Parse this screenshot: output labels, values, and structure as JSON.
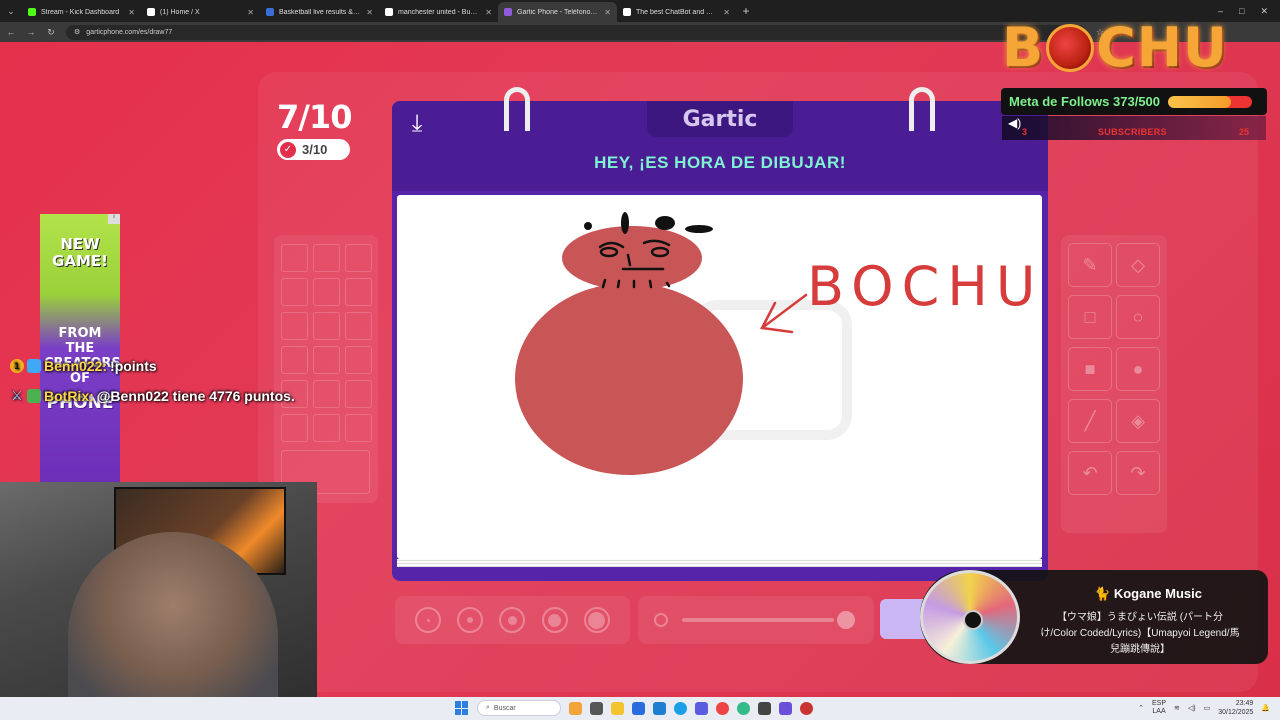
{
  "browser": {
    "tabs": [
      {
        "label": "Stream - Kick Dashboard",
        "favicon_color": "#53fc18",
        "active": false
      },
      {
        "label": "(1) Home / X",
        "favicon_color": "#ffffff",
        "active": false
      },
      {
        "label": "Basketball live results & schedu...",
        "favicon_color": "#3b6fd8",
        "active": false
      },
      {
        "label": "manchester united - Buscar con...",
        "favicon_color": "#ffffff",
        "active": false
      },
      {
        "label": "Gartic Phone - Teléfono De...",
        "favicon_color": "#8f5bd8",
        "active": true
      },
      {
        "label": "The best ChatBot and Widg...",
        "favicon_color": "#ffffff",
        "active": false
      }
    ],
    "url": "garticphone.com/es/draw77"
  },
  "game": {
    "round": "7/10",
    "players_done": "3/10",
    "logo": "Gartic",
    "instruction": "HEY, ¡ES HORA DE DIBUJAR!",
    "drawing_text": "BOCHU"
  },
  "palette": {
    "rows": 6,
    "cols": 3
  },
  "tools": [
    {
      "name": "pencil-tool-icon",
      "glyph": "✎"
    },
    {
      "name": "eraser-tool-icon",
      "glyph": "◇"
    },
    {
      "name": "rectangle-tool-icon",
      "glyph": "□"
    },
    {
      "name": "ellipse-tool-icon",
      "glyph": "○"
    },
    {
      "name": "filled-rectangle-tool-icon",
      "glyph": "■"
    },
    {
      "name": "filled-ellipse-tool-icon",
      "glyph": "●"
    },
    {
      "name": "line-tool-icon",
      "glyph": "╱"
    },
    {
      "name": "fill-bucket-tool-icon",
      "glyph": "◈"
    },
    {
      "name": "undo-icon",
      "glyph": "↶"
    },
    {
      "name": "redo-icon",
      "glyph": "↷"
    }
  ],
  "overlay": {
    "brand": "BOCHU",
    "follow_goal_label": "Meta de Follows 373/500",
    "follow_goal_progress": 0.746,
    "subs_label": "SUBSCRIBERS",
    "subs_left": "3",
    "subs_right": "25",
    "ad_newgame": "NEW GAME!",
    "ad_creators": "FROM THE CREATORS OF",
    "ad_phone": "PHONE",
    "chat": [
      {
        "user": "Benn022:",
        "message": "!points"
      },
      {
        "user": "BotRix:",
        "message": "@Benn022 tiene 4776 puntos."
      }
    ],
    "music_title": "🐈 Kogane Music",
    "music_track": "【ウマ娘】うまぴょい伝説 (パート分け/Color Coded/Lyrics)【Umapyoi Legend/馬兒蹦跳傳說】"
  },
  "taskbar": {
    "search_placeholder": "Buscar",
    "lang": "ESP",
    "region": "LAA",
    "time": "23:49",
    "date": "30/12/2025"
  },
  "colors": {
    "accent": "#e2304c",
    "board": "#5524a8",
    "instruction": "#7ff2d2",
    "ink": "#d95a5a"
  }
}
